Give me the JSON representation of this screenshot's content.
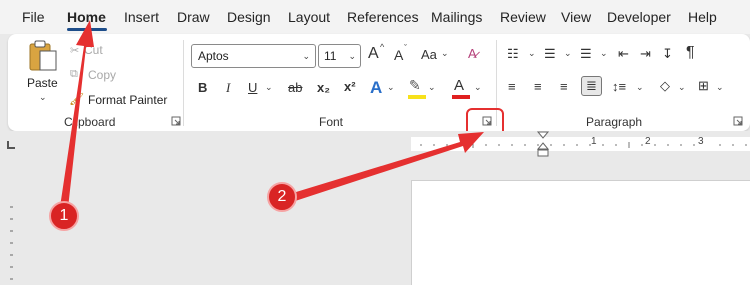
{
  "menu": {
    "items": [
      "File",
      "Home",
      "Insert",
      "Draw",
      "Design",
      "Layout",
      "References",
      "Mailings",
      "Review",
      "View",
      "Developer",
      "Help"
    ]
  },
  "clipboard": {
    "paste_label": "Paste",
    "cut_label": "Cut",
    "copy_label": "Copy",
    "format_painter_label": "Format Painter",
    "group_label": "Clipboard"
  },
  "font": {
    "font_name": "Aptos",
    "font_size": "11",
    "grow_label": "A",
    "shrink_label": "A",
    "case_label": "Aa",
    "bold_label": "B",
    "italic_label": "I",
    "underline_label": "U",
    "strike_label": "ab",
    "subscript_label": "x₂",
    "superscript_label": "x²",
    "effects_label": "A",
    "font_color_label": "A",
    "group_label": "Font",
    "highlight_color": "#f7e11b",
    "font_color": "#e02020"
  },
  "paragraph": {
    "group_label": "Paragraph",
    "pilcrow": "¶"
  },
  "ruler": {
    "numbers": [
      "1",
      "2",
      "3"
    ]
  },
  "annotations": {
    "badge_1": "1",
    "badge_2": "2",
    "arrow_color": "#e53030"
  }
}
